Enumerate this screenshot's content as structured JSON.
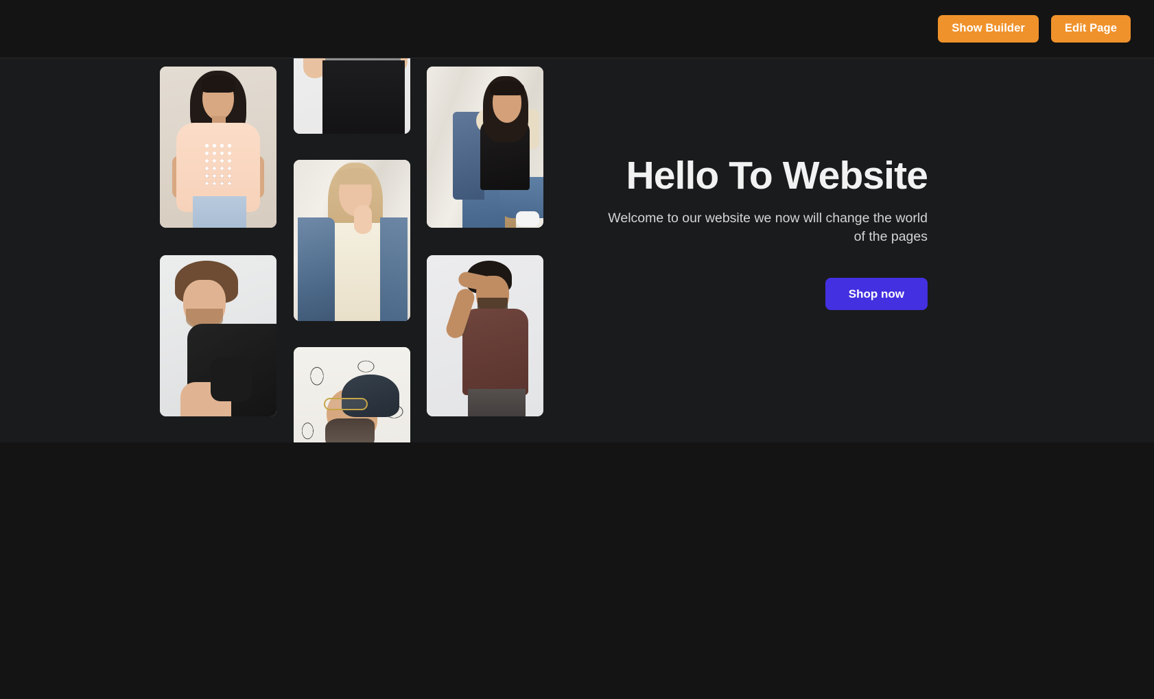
{
  "topbar": {
    "show_builder_label": "Show Builder",
    "edit_page_label": "Edit Page",
    "button_color": "#f0922b",
    "background": "#141414"
  },
  "hero": {
    "background": "#1a1b1d",
    "title": "Hello To Website",
    "subtitle": "Welcome to our website we now will change the world of the pages",
    "cta_label": "Shop now",
    "cta_color": "#4330e0",
    "title_color": "#f2f2f2",
    "subtitle_color": "#d4d4d6"
  },
  "gallery": {
    "columns": [
      {
        "name": "column-1",
        "photos": [
          {
            "alt": "Woman in peach dot-print tee and light jeans on beige backdrop"
          },
          {
            "alt": "Man in black tee facing away on light grey backdrop"
          }
        ]
      },
      {
        "name": "column-2",
        "photos": [
          {
            "alt": "Cropped torso of man in heather grey tee and black jeans"
          },
          {
            "alt": "Blonde woman in denim jacket over cream tee on draped backdrop"
          },
          {
            "alt": "Bearded man in navy beanie and glasses against graffiti wall"
          }
        ]
      },
      {
        "name": "column-3",
        "photos": [
          {
            "alt": "Woman in denim sherpa jacket and black tee seated on wooden stool"
          },
          {
            "alt": "Man in maroon tee with hand on head on light grey backdrop"
          }
        ]
      }
    ]
  },
  "below_fold": {
    "background": "#141414"
  }
}
